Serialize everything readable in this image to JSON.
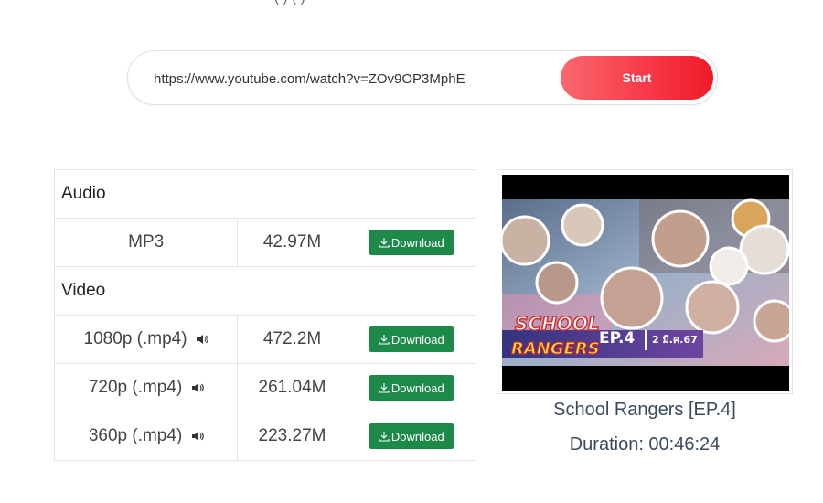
{
  "header": {
    "top_text": "( ) ( )"
  },
  "search": {
    "url_value": "https://www.youtube.com/watch?v=ZOv9OP3MphE",
    "start_label": "Start"
  },
  "table": {
    "audio_heading": "Audio",
    "video_heading": "Video",
    "audio_rows": [
      {
        "format": "MP3",
        "size": "42.97M",
        "button": "Download"
      }
    ],
    "video_rows": [
      {
        "format": "1080p (.mp4)",
        "size": "472.2M",
        "button": "Download"
      },
      {
        "format": "720p (.mp4)",
        "size": "261.04M",
        "button": "Download"
      },
      {
        "format": "360p (.mp4)",
        "size": "223.27M",
        "button": "Download"
      }
    ]
  },
  "video": {
    "thumbnail_logo_line1": "SCHOOL",
    "thumbnail_logo_line2": "RANGERS",
    "thumbnail_episode": "EP.4",
    "thumbnail_date": "2 มี.ค.67",
    "title": "School Rangers [EP.4]",
    "duration": "Duration: 00:46:24"
  },
  "colors": {
    "start_gradient_end": "#f01a26",
    "download_green": "#1e8a4a",
    "title_text": "#3a4a5c"
  }
}
